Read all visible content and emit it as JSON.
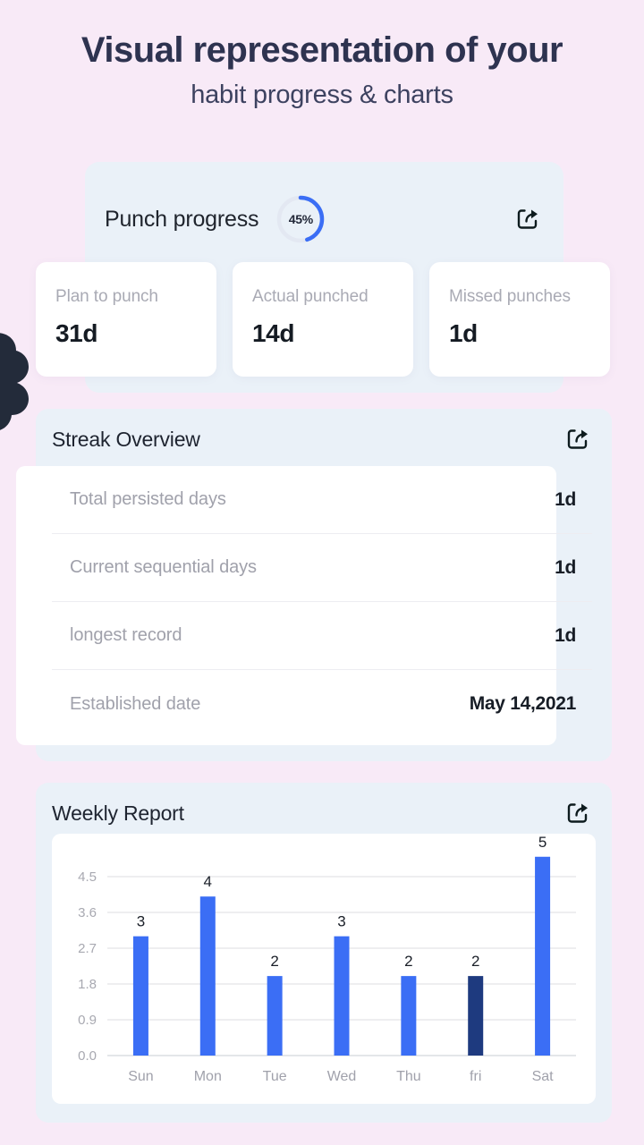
{
  "header": {
    "title_line1": "Visual representation of your",
    "title_line2": "habit progress & charts"
  },
  "punch_progress": {
    "label": "Punch progress",
    "percent_text": "45%",
    "percent_value": 45,
    "share_icon": "share-icon",
    "stats": [
      {
        "label": "Plan to punch",
        "value": "31d"
      },
      {
        "label": "Actual punched",
        "value": "14d"
      },
      {
        "label": "Missed punches",
        "value": "1d"
      }
    ]
  },
  "streak_overview": {
    "title": "Streak Overview",
    "share_icon": "share-icon",
    "rows": [
      {
        "key": "Total persisted days",
        "value": "1d"
      },
      {
        "key": "Current sequential days",
        "value": "1d"
      },
      {
        "key": "longest record",
        "value": "1d"
      },
      {
        "key": "Established date",
        "value": "May 14,2021"
      }
    ]
  },
  "weekly_report": {
    "title": "Weekly Report",
    "share_icon": "share-icon"
  },
  "chart_data": {
    "type": "bar",
    "title": "Weekly Report",
    "xlabel": "",
    "ylabel": "",
    "categories": [
      "Sun",
      "Mon",
      "Tue",
      "Wed",
      "Thu",
      "fri",
      "Sat"
    ],
    "values": [
      3,
      4,
      2,
      3,
      2,
      2,
      5
    ],
    "bar_labels": [
      "3",
      "4",
      "2",
      "3",
      "2",
      "2",
      "5"
    ],
    "highlighted_index": 5,
    "ylim": [
      0,
      4.5
    ],
    "yticks": [
      0.0,
      0.9,
      1.8,
      2.7,
      3.6,
      4.5
    ],
    "ytick_labels": [
      "0.0",
      "0.9",
      "1.8",
      "2.7",
      "3.6",
      "4.5"
    ],
    "grid": true,
    "legend": null,
    "colors": {
      "bar": "#3b6ef5",
      "bar_highlight": "#1e3a7f",
      "grid": "#dcdde2",
      "tick_text": "#a8a9b1"
    }
  },
  "theme": {
    "background": "#f8eaf7",
    "card_background": "#eaf1f8",
    "panel_white": "#ffffff",
    "accent_blue": "#3b6ef5",
    "accent_navy": "#1e3a7f",
    "title_color": "#2e3350",
    "muted_text": "#a0a1ab"
  }
}
